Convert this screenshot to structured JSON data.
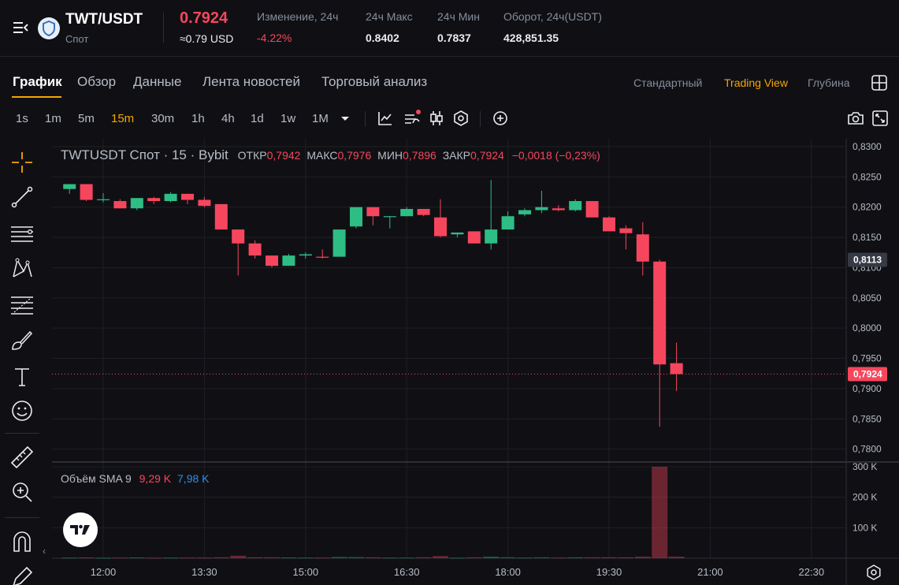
{
  "header": {
    "pair": "TWT/USDT",
    "market_type": "Спот",
    "last_price": "0.7924",
    "usd_price": "≈0.79 USD",
    "stats": [
      {
        "label": "Изменение, 24ч",
        "value": "-4.22%",
        "negative": true
      },
      {
        "label": "24ч Макс",
        "value": "0.8402",
        "negative": false
      },
      {
        "label": "24ч Мин",
        "value": "0.7837",
        "negative": false
      },
      {
        "label": "Оборот, 24ч(USDT)",
        "value": "428,851.35",
        "negative": false
      }
    ]
  },
  "tabs": [
    "График",
    "Обзор",
    "Данные",
    "Лента новостей",
    "Торговый анализ"
  ],
  "active_tab": "График",
  "view_modes": [
    "Стандартный",
    "Trading View",
    "Глубина"
  ],
  "active_view_mode": "Trading View",
  "intervals": [
    "1s",
    "1m",
    "5m",
    "15m",
    "30m",
    "1h",
    "4h",
    "1d",
    "1w",
    "1M"
  ],
  "active_interval": "15m",
  "toolbar_icons": [
    "chevron-down-icon",
    "line-chart-icon",
    "indicators-icon",
    "candles-icon",
    "hexagon-settings-icon",
    "add-compare-icon",
    "camera-icon",
    "fullscreen-icon"
  ],
  "left_tools": [
    "crosshair-icon",
    "trend-line-icon",
    "horizontal-lines-icon",
    "pattern-icon",
    "fib-icon",
    "brush-icon",
    "text-icon",
    "emoji-icon",
    "ruler-icon",
    "zoom-in-icon",
    "magnet-icon",
    "pencil-icon"
  ],
  "legend": {
    "symbol": "TWTUSDT Спот · 15 · Bybit",
    "open_label": "ОТКР",
    "open": "0,7942",
    "high_label": "МАКС",
    "high": "0,7976",
    "low_label": "МИН",
    "low": "0,7896",
    "close_label": "ЗАКР",
    "close": "0,7924",
    "change": "−0,0018 (−0,23%)"
  },
  "volume_legend": {
    "label": "Объём SMA 9",
    "value1": "9,29 K",
    "value2": "7,98 K"
  },
  "colors": {
    "up": "#2ebd85",
    "down": "#f6465d",
    "accent": "#f7a600",
    "background": "#101014",
    "grid": "#1e1f25"
  },
  "chart_data": {
    "type": "candlestick",
    "time_ticks": [
      "12:00",
      "13:30",
      "15:00",
      "16:30",
      "18:00",
      "19:30",
      "21:00",
      "22:30"
    ],
    "time_tick_minutes": [
      720,
      810,
      900,
      990,
      1080,
      1170,
      1260,
      1350
    ],
    "price_ticks": [
      "0,8300",
      "0,8250",
      "0,8200",
      "0,8150",
      "0,8100",
      "0,8050",
      "0,8000",
      "0,7950",
      "0,7900",
      "0,7850",
      "0,7800"
    ],
    "ylim": [
      0.778,
      0.8313
    ],
    "volume_ticks": [
      "300 K",
      "200 K",
      "100 K"
    ],
    "volume_ylim": [
      0,
      300000
    ],
    "price_labels": [
      {
        "value": 0.8113,
        "text": "0,8113",
        "style": "gray"
      },
      {
        "value": 0.7924,
        "text": "0,7924",
        "style": "red"
      }
    ],
    "candles": [
      {
        "t": 690,
        "o": 0.823,
        "h": 0.8238,
        "l": 0.8222,
        "c": 0.8238,
        "v": 2000
      },
      {
        "t": 705,
        "o": 0.8238,
        "h": 0.8238,
        "l": 0.821,
        "c": 0.8212,
        "v": 2500
      },
      {
        "t": 720,
        "o": 0.8213,
        "h": 0.8223,
        "l": 0.8208,
        "c": 0.8213,
        "v": 1500
      },
      {
        "t": 735,
        "o": 0.821,
        "h": 0.8213,
        "l": 0.82,
        "c": 0.8198,
        "v": 2000
      },
      {
        "t": 750,
        "o": 0.8198,
        "h": 0.8215,
        "l": 0.8195,
        "c": 0.8215,
        "v": 2500
      },
      {
        "t": 765,
        "o": 0.8215,
        "h": 0.8217,
        "l": 0.8205,
        "c": 0.821,
        "v": 1500
      },
      {
        "t": 780,
        "o": 0.821,
        "h": 0.8225,
        "l": 0.8208,
        "c": 0.8222,
        "v": 2000
      },
      {
        "t": 795,
        "o": 0.8222,
        "h": 0.8222,
        "l": 0.8205,
        "c": 0.8212,
        "v": 2000
      },
      {
        "t": 810,
        "o": 0.8212,
        "h": 0.8217,
        "l": 0.82,
        "c": 0.8202,
        "v": 2000
      },
      {
        "t": 825,
        "o": 0.8205,
        "h": 0.8205,
        "l": 0.8163,
        "c": 0.8163,
        "v": 3000
      },
      {
        "t": 840,
        "o": 0.8163,
        "h": 0.8163,
        "l": 0.8087,
        "c": 0.814,
        "v": 8000
      },
      {
        "t": 855,
        "o": 0.814,
        "h": 0.8145,
        "l": 0.8115,
        "c": 0.812,
        "v": 3000
      },
      {
        "t": 870,
        "o": 0.812,
        "h": 0.812,
        "l": 0.81,
        "c": 0.8103,
        "v": 3000
      },
      {
        "t": 885,
        "o": 0.8103,
        "h": 0.8123,
        "l": 0.8103,
        "c": 0.812,
        "v": 2500
      },
      {
        "t": 900,
        "o": 0.812,
        "h": 0.8125,
        "l": 0.8115,
        "c": 0.8122,
        "v": 2000
      },
      {
        "t": 915,
        "o": 0.8118,
        "h": 0.813,
        "l": 0.8115,
        "c": 0.8117,
        "v": 2000
      },
      {
        "t": 930,
        "o": 0.8118,
        "h": 0.8163,
        "l": 0.8118,
        "c": 0.8163,
        "v": 4000
      },
      {
        "t": 945,
        "o": 0.8168,
        "h": 0.82,
        "l": 0.8165,
        "c": 0.82,
        "v": 3500
      },
      {
        "t": 960,
        "o": 0.82,
        "h": 0.82,
        "l": 0.817,
        "c": 0.8185,
        "v": 3000
      },
      {
        "t": 975,
        "o": 0.8185,
        "h": 0.8185,
        "l": 0.8165,
        "c": 0.8185,
        "v": 2000
      },
      {
        "t": 990,
        "o": 0.8185,
        "h": 0.82,
        "l": 0.8185,
        "c": 0.8197,
        "v": 2000
      },
      {
        "t": 1005,
        "o": 0.8197,
        "h": 0.8197,
        "l": 0.8185,
        "c": 0.8187,
        "v": 3000
      },
      {
        "t": 1020,
        "o": 0.8183,
        "h": 0.8213,
        "l": 0.815,
        "c": 0.8152,
        "v": 7000
      },
      {
        "t": 1035,
        "o": 0.8155,
        "h": 0.8158,
        "l": 0.815,
        "c": 0.8158,
        "v": 1500
      },
      {
        "t": 1050,
        "o": 0.816,
        "h": 0.816,
        "l": 0.814,
        "c": 0.814,
        "v": 3000
      },
      {
        "t": 1065,
        "o": 0.814,
        "h": 0.8245,
        "l": 0.813,
        "c": 0.8163,
        "v": 5000
      },
      {
        "t": 1080,
        "o": 0.8163,
        "h": 0.8193,
        "l": 0.8163,
        "c": 0.8185,
        "v": 3000
      },
      {
        "t": 1095,
        "o": 0.8188,
        "h": 0.8198,
        "l": 0.8185,
        "c": 0.8195,
        "v": 2000
      },
      {
        "t": 1110,
        "o": 0.8195,
        "h": 0.8227,
        "l": 0.819,
        "c": 0.82,
        "v": 3000
      },
      {
        "t": 1125,
        "o": 0.8198,
        "h": 0.8203,
        "l": 0.8193,
        "c": 0.8195,
        "v": 2000
      },
      {
        "t": 1140,
        "o": 0.8195,
        "h": 0.8213,
        "l": 0.8193,
        "c": 0.821,
        "v": 3000
      },
      {
        "t": 1155,
        "o": 0.821,
        "h": 0.821,
        "l": 0.8183,
        "c": 0.8183,
        "v": 3000
      },
      {
        "t": 1170,
        "o": 0.8183,
        "h": 0.8185,
        "l": 0.816,
        "c": 0.816,
        "v": 3000
      },
      {
        "t": 1185,
        "o": 0.8165,
        "h": 0.817,
        "l": 0.813,
        "c": 0.8157,
        "v": 3000
      },
      {
        "t": 1200,
        "o": 0.8155,
        "h": 0.8175,
        "l": 0.8087,
        "c": 0.811,
        "v": 5000
      },
      {
        "t": 1215,
        "o": 0.811,
        "h": 0.8113,
        "l": 0.7837,
        "c": 0.794,
        "v": 300000
      },
      {
        "t": 1230,
        "o": 0.7942,
        "h": 0.7976,
        "l": 0.7896,
        "c": 0.7924,
        "v": 5000
      }
    ]
  }
}
